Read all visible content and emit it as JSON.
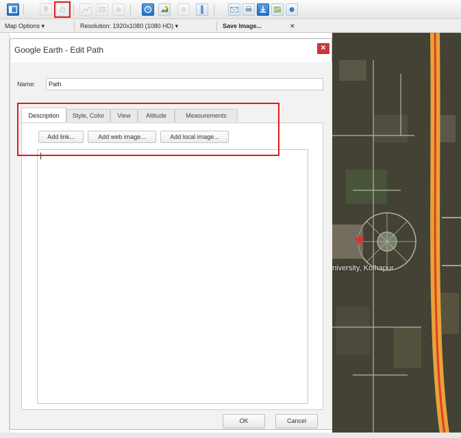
{
  "toolbar": {
    "buttons": [
      {
        "icon": "sidebar-toggle-icon",
        "style": "blue"
      },
      {
        "icon": "add-placemark-icon",
        "style": "ghost"
      },
      {
        "icon": "add-polygon-icon",
        "style": "ghost"
      },
      {
        "icon": "add-path-icon",
        "style": "ghost"
      },
      {
        "icon": "add-overlay-icon",
        "style": "ghost"
      },
      {
        "icon": "record-tour-icon",
        "style": "ghost"
      },
      {
        "icon": "historical-imagery-icon",
        "style": "blue"
      },
      {
        "icon": "sunlight-icon",
        "style": "normal"
      },
      {
        "icon": "switch-to-sky-icon",
        "style": "ghost"
      },
      {
        "icon": "ruler-icon",
        "style": "normal"
      },
      {
        "icon": "email-icon",
        "style": "normal"
      },
      {
        "icon": "print-icon",
        "style": "normal"
      },
      {
        "icon": "save-image-icon",
        "style": "blue"
      },
      {
        "icon": "view-in-maps-icon",
        "style": "normal"
      },
      {
        "icon": "sign-in-icon",
        "style": "normal"
      }
    ],
    "highlight_color": "#e0191c"
  },
  "options_bar": {
    "map_options": "Map Options",
    "map_options_arrow": "▾",
    "resolution": "Resolution: 1920x1080 (1080 HD)",
    "resolution_arrow": "▾",
    "save_image": "Save Image...",
    "close": "✕"
  },
  "dialog": {
    "title": "Google Earth - Edit Path",
    "close_glyph": "✕",
    "name_label": "Name:",
    "name_value": "Path",
    "tabs": [
      "Description",
      "Style, Color",
      "View",
      "Altitude",
      "Measurements"
    ],
    "active_tab": "Description",
    "insert_buttons": [
      "Add link...",
      "Add web image...",
      "Add local image..."
    ],
    "description_text": "",
    "ok": "OK",
    "cancel": "Cancel"
  },
  "map": {
    "label": "niversity, Kolhapur"
  },
  "colors": {
    "accent_red": "#e0191c",
    "close_red": "#c9373b",
    "road": "#e0a43a",
    "path": "#e83a1f"
  }
}
